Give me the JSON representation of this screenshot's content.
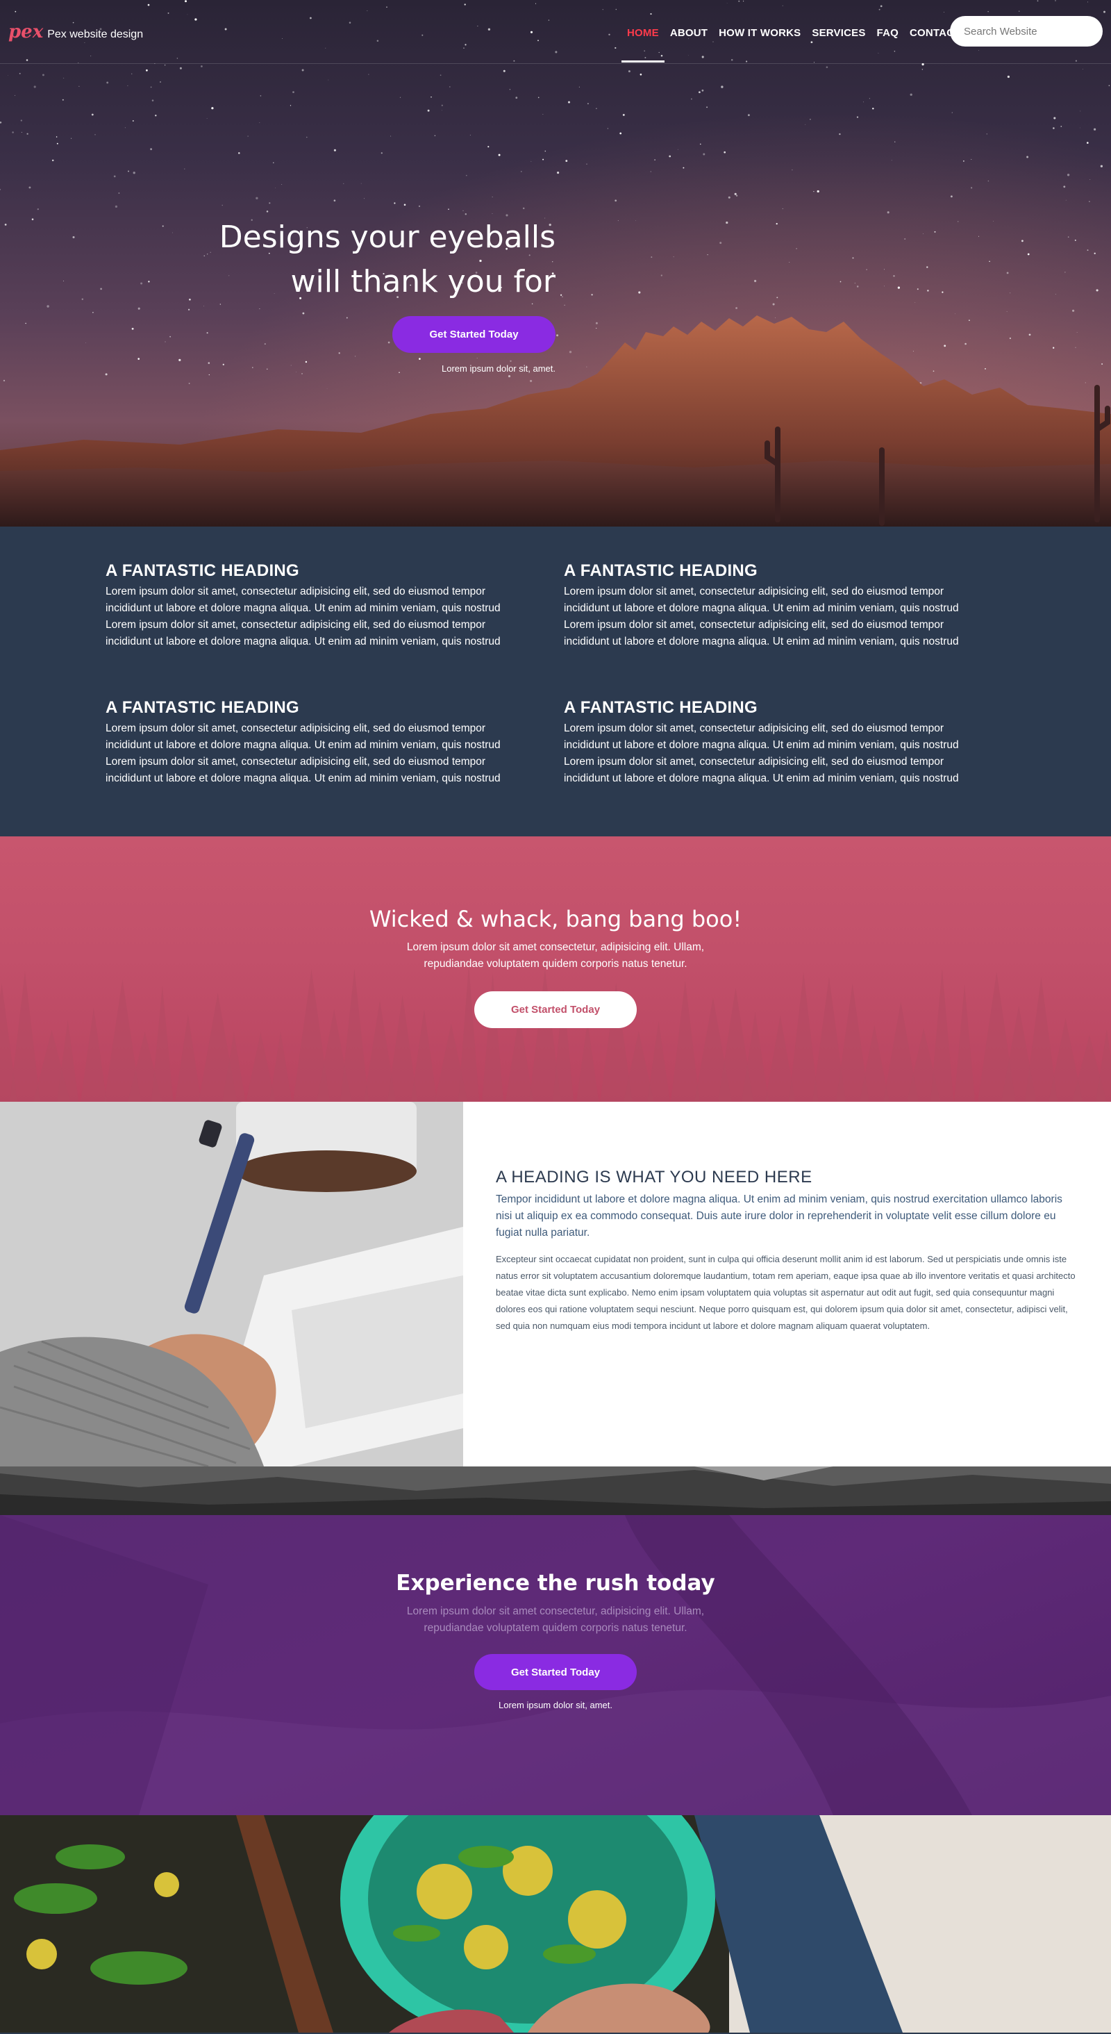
{
  "brand": {
    "logo": "pex",
    "name": "Pex website design"
  },
  "nav": {
    "items": [
      "HOME",
      "ABOUT",
      "HOW IT WORKS",
      "SERVICES",
      "FAQ",
      "CONTACT"
    ],
    "active": "HOME",
    "search_placeholder": "Search Website"
  },
  "hero": {
    "title_line1": "Designs your eyeballs",
    "title_line2": "will thank you for",
    "button": "Get Started Today",
    "caption": "Lorem ipsum dolor sit, amet."
  },
  "features": [
    {
      "heading": "A FANTASTIC HEADING",
      "text": "Lorem ipsum dolor sit amet, consectetur adipisicing elit, sed do eiusmod tempor incididunt ut labore et dolore magna aliqua. Ut enim ad minim veniam, quis nostrud Lorem ipsum dolor sit amet, consectetur adipisicing elit, sed do eiusmod tempor incididunt ut labore et dolore magna aliqua. Ut enim ad minim veniam, quis nostrud"
    },
    {
      "heading": "A FANTASTIC HEADING",
      "text": "Lorem ipsum dolor sit amet, consectetur adipisicing elit, sed do eiusmod tempor incididunt ut labore et dolore magna aliqua. Ut enim ad minim veniam, quis nostrud Lorem ipsum dolor sit amet, consectetur adipisicing elit, sed do eiusmod tempor incididunt ut labore et dolore magna aliqua. Ut enim ad minim veniam, quis nostrud"
    },
    {
      "heading": "A FANTASTIC HEADING",
      "text": "Lorem ipsum dolor sit amet, consectetur adipisicing elit, sed do eiusmod tempor incididunt ut labore et dolore magna aliqua. Ut enim ad minim veniam, quis nostrud Lorem ipsum dolor sit amet, consectetur adipisicing elit, sed do eiusmod tempor incididunt ut labore et dolore magna aliqua. Ut enim ad minim veniam, quis nostrud"
    },
    {
      "heading": "A FANTASTIC HEADING",
      "text": "Lorem ipsum dolor sit amet, consectetur adipisicing elit, sed do eiusmod tempor incididunt ut labore et dolore magna aliqua. Ut enim ad minim veniam, quis nostrud Lorem ipsum dolor sit amet, consectetur adipisicing elit, sed do eiusmod tempor incididunt ut labore et dolore magna aliqua. Ut enim ad minim veniam, quis nostrud"
    }
  ],
  "cta_red": {
    "title": "Wicked & whack, bang bang boo!",
    "text": "Lorem ipsum dolor sit amet consectetur, adipisicing elit. Ullam, repudiandae voluptatem quidem corporis natus tenetur.",
    "button": "Get Started Today"
  },
  "split": {
    "heading": "A HEADING IS WHAT YOU NEED HERE",
    "lead": "Tempor incididunt ut labore et dolore magna aliqua. Ut enim ad minim veniam, quis nostrud exercitation ullamco laboris nisi ut aliquip ex ea commodo consequat. Duis aute irure dolor in reprehenderit in voluptate velit esse cillum dolore eu fugiat nulla pariatur.",
    "body": "Excepteur sint occaecat cupidatat non proident, sunt in culpa qui officia deserunt mollit anim id est laborum. Sed ut perspiciatis unde omnis iste natus error sit voluptatem accusantium doloremque laudantium, totam rem aperiam, eaque ipsa quae ab illo inventore veritatis et quasi architecto beatae vitae dicta sunt explicabo. Nemo enim ipsam voluptatem quia voluptas sit aspernatur aut odit aut fugit, sed quia consequuntur magni dolores eos qui ratione voluptatem sequi nesciunt. Neque porro quisquam est, qui dolorem ipsum quia dolor sit amet, consectetur, adipisci velit, sed quia non numquam eius modi tempora incidunt ut labore et dolore magnam aliquam quaerat voluptatem."
  },
  "cta_purple": {
    "title": "Experience the rush today",
    "text": "Lorem ipsum dolor sit amet consectetur, adipisicing elit. Ullam, repudiandae voluptatem quidem corporis natus tenetur.",
    "button": "Get Started Today",
    "caption": "Lorem ipsum dolor sit, amet."
  },
  "colors": {
    "accent_purple": "#8a2be2",
    "active_nav": "#ff3b4b",
    "features_bg": "#2c3a4f",
    "cta_red_bg": "#c2506a",
    "cta_purple_bg": "#5a2a74"
  }
}
